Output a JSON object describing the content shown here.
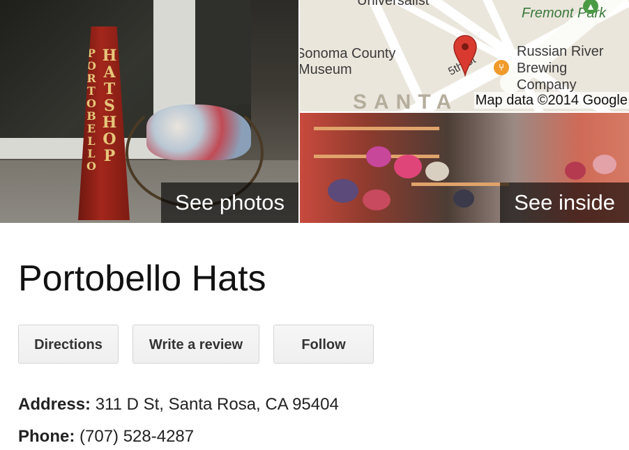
{
  "photos": {
    "main_label": "See photos",
    "inside_label": "See inside",
    "sign_text": "PORTOBELLO",
    "sign_text_2": "HAT SHOP"
  },
  "map": {
    "labels": {
      "universalist": "Universalist",
      "park": "Fremont Park",
      "museum_line1": "Sonoma County",
      "museum_line2": "Museum",
      "brewery_line1": "Russian River",
      "brewery_line2": "Brewing",
      "brewery_line3": "Company",
      "street": "5th St",
      "area": "SANTA"
    },
    "copyright": "Map data ©2014 Google",
    "pin_color": "#d93a2f"
  },
  "place": {
    "name": "Portobello Hats"
  },
  "actions": {
    "directions": "Directions",
    "write_review": "Write a review",
    "follow": "Follow"
  },
  "details": {
    "address_label": "Address:",
    "address_value": "311 D St, Santa Rosa, CA 95404",
    "phone_label": "Phone:",
    "phone_value": "(707) 528-4287"
  }
}
